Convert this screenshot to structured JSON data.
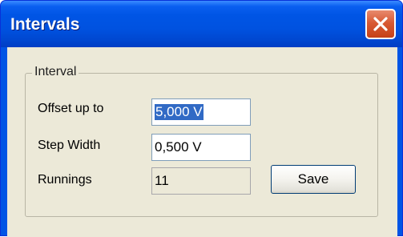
{
  "window": {
    "title": "Intervals"
  },
  "group": {
    "label": "Interval"
  },
  "fields": {
    "offset": {
      "label": "Offset up to",
      "value": "5,000 V"
    },
    "step": {
      "label": "Step Width",
      "value": "0,500 V"
    },
    "runnings": {
      "label": "Runnings",
      "value": "11"
    }
  },
  "buttons": {
    "save_label": "Save"
  },
  "icons": {
    "close": "close-icon"
  },
  "colors": {
    "titlebar": "#0055e5",
    "close_button": "#d85a34",
    "dialog_face": "#ece9d8",
    "selection": "#316ac5"
  }
}
